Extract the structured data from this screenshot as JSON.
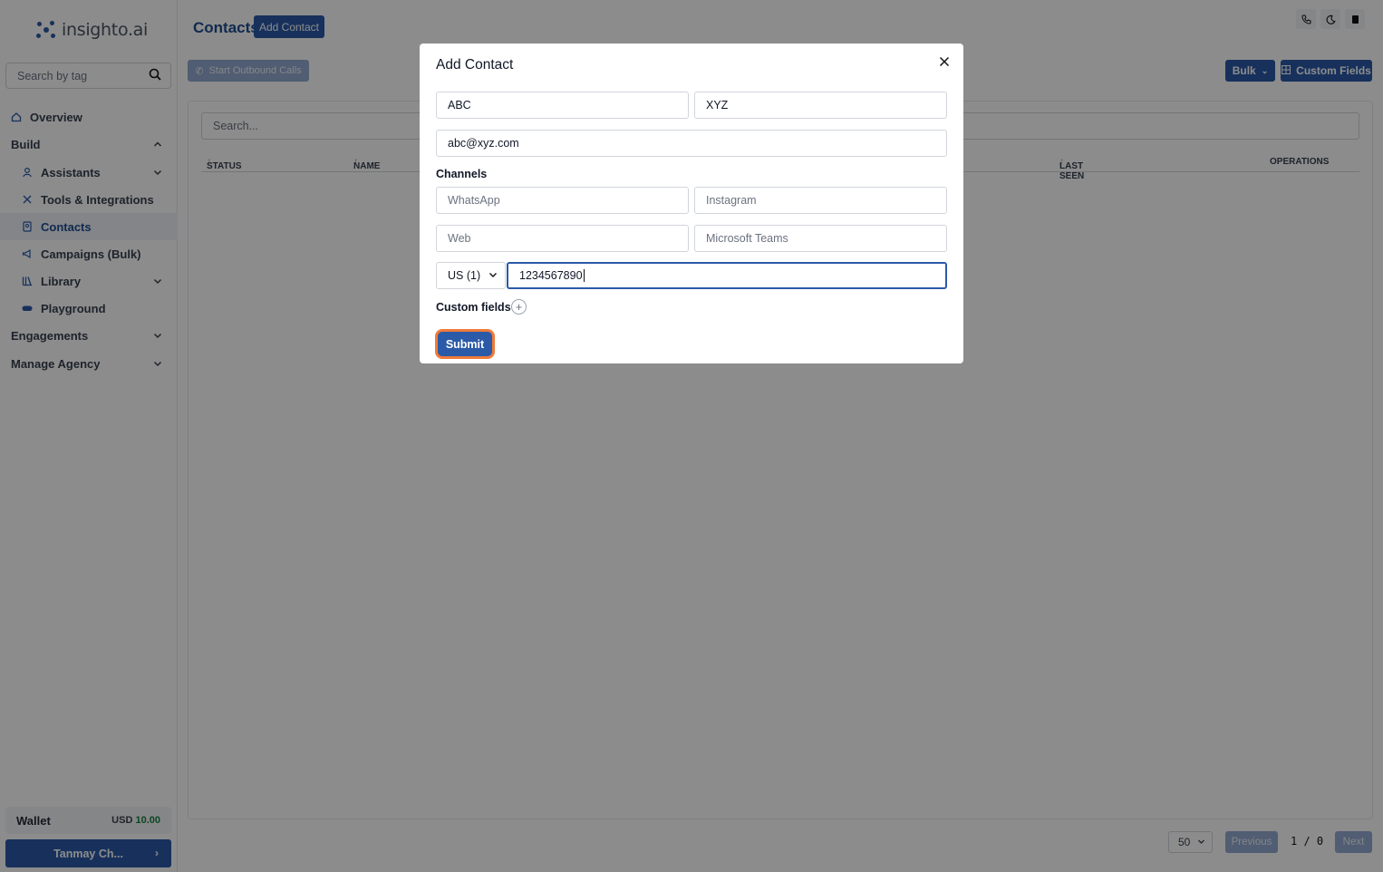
{
  "brand": {
    "name": "insighto.ai",
    "accent": "#2b5aa8"
  },
  "sidebar": {
    "search_placeholder": "Search by tag",
    "items": [
      {
        "label": "Overview",
        "icon": "home-icon"
      },
      {
        "label": "Build",
        "icon": "chevron-up-icon"
      },
      {
        "label": "Assistants",
        "icon": "user-icon"
      },
      {
        "label": "Tools & Integrations",
        "icon": "tools-icon"
      },
      {
        "label": "Contacts",
        "icon": "contacts-icon"
      },
      {
        "label": "Campaigns (Bulk)",
        "icon": "megaphone-icon"
      },
      {
        "label": "Library",
        "icon": "library-icon"
      },
      {
        "label": "Playground",
        "icon": "gamepad-icon"
      },
      {
        "label": "Engagements",
        "icon": "chevron-down-icon"
      },
      {
        "label": "Manage Agency",
        "icon": "chevron-down-icon"
      }
    ],
    "wallet": {
      "label": "Wallet",
      "currency": "USD",
      "amount": "10.00"
    },
    "user": {
      "name": "Tanmay Ch...",
      "arrow": "›"
    }
  },
  "header": {
    "title": "Contacts",
    "add_button": "Add Contact",
    "outbound_button": "Start Outbound Calls",
    "bulk_button": "Bulk",
    "custom_fields_button": "Custom Fields"
  },
  "table": {
    "search_placeholder": "Search...",
    "columns": [
      "STATUS",
      "NAME",
      "LAST SEEN",
      "OPERATIONS"
    ]
  },
  "pagination": {
    "page_size": "50",
    "previous": "Previous",
    "indicator": "1 / 0",
    "next": "Next"
  },
  "modal": {
    "title": "Add Contact",
    "first_name": "ABC",
    "last_name": "XYZ",
    "email": "abc@xyz.com",
    "channels_label": "Channels",
    "whatsapp_placeholder": "WhatsApp",
    "instagram_placeholder": "Instagram",
    "web_placeholder": "Web",
    "teams_placeholder": "Microsoft Teams",
    "country_code": "US (1)",
    "phone": "1234567890",
    "custom_fields_label": "Custom fields",
    "submit": "Submit"
  }
}
